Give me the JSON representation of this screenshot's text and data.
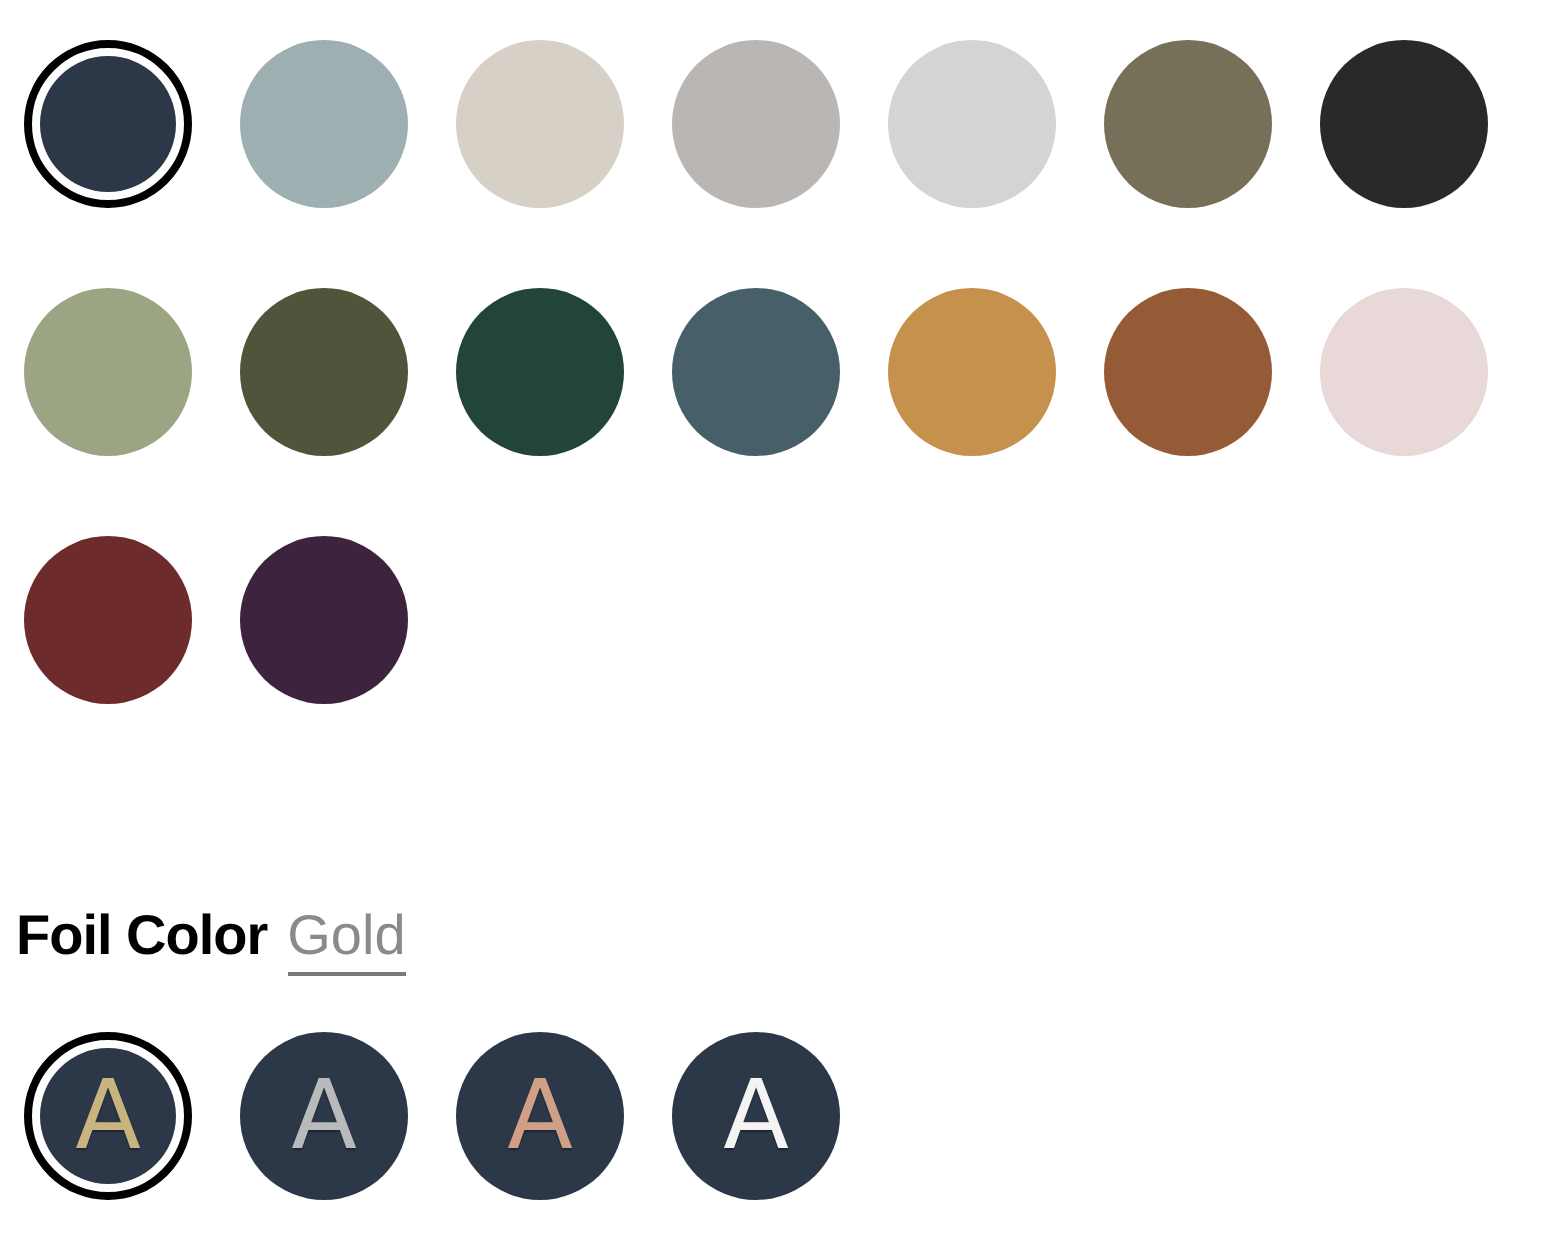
{
  "colors": [
    {
      "color": "#2c3848",
      "selected": true
    },
    {
      "color": "#9eafb1",
      "selected": false
    },
    {
      "color": "#d6d0c7",
      "selected": false
    },
    {
      "color": "#bab6b3",
      "selected": false
    },
    {
      "color": "#d4d4d4",
      "selected": false
    },
    {
      "color": "#767059",
      "selected": false
    },
    {
      "color": "#292929",
      "selected": false
    },
    {
      "color": "#9ba483",
      "selected": false
    },
    {
      "color": "#4f543b",
      "selected": false
    },
    {
      "color": "#22443b",
      "selected": false
    },
    {
      "color": "#465f69",
      "selected": false
    },
    {
      "color": "#c5924e",
      "selected": false
    },
    {
      "color": "#955b36",
      "selected": false
    },
    {
      "color": "#e8d8d8",
      "selected": false
    },
    {
      "color": "#6e2b2b",
      "selected": false
    },
    {
      "color": "#3e233f",
      "selected": false
    }
  ],
  "foil": {
    "label": "Foil Color",
    "value": "Gold",
    "options": [
      {
        "letter": "A",
        "color": "#c8b47f",
        "selected": true
      },
      {
        "letter": "A",
        "color": "#b9babb",
        "selected": false
      },
      {
        "letter": "A",
        "color": "#cf9f86",
        "selected": false
      },
      {
        "letter": "A",
        "color": "#f4f4f4",
        "selected": false
      }
    ]
  }
}
